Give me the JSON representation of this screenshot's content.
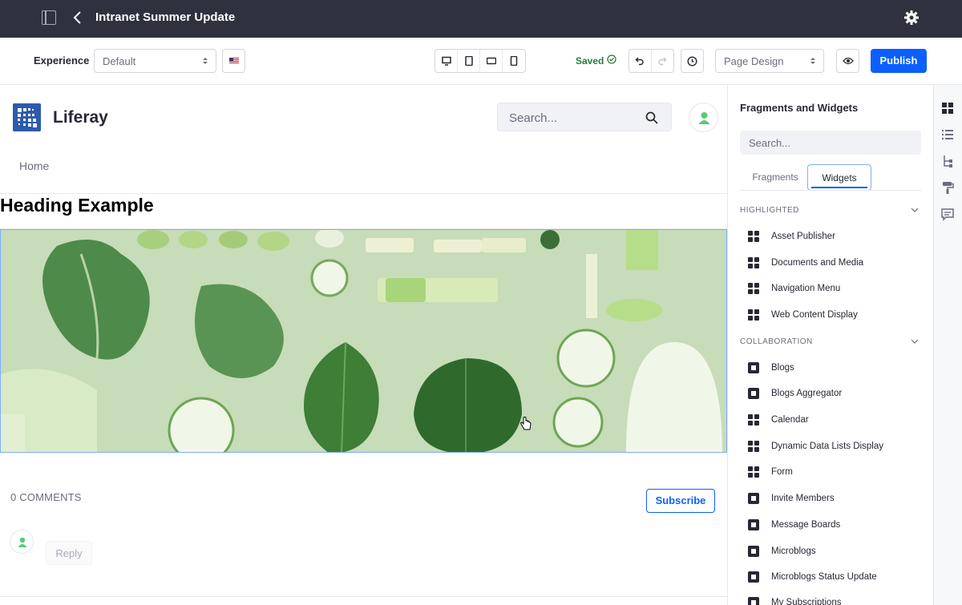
{
  "topbar": {
    "title": "Intranet Summer Update"
  },
  "toolbar": {
    "experience_label": "Experience",
    "experience_value": "Default",
    "saved_label": "Saved",
    "mode_value": "Page Design",
    "publish_label": "Publish"
  },
  "canvas": {
    "logo_text": "Liferay",
    "search_placeholder": "Search...",
    "nav_home": "Home",
    "heading": "Heading Example",
    "comments_label": "0 COMMENTS",
    "subscribe_label": "Subscribe",
    "reply_label": "Reply"
  },
  "panel": {
    "title": "Fragments and Widgets",
    "search_placeholder": "Search...",
    "tabs": [
      "Fragments",
      "Widgets"
    ],
    "active_tab": "Widgets",
    "sections": [
      {
        "name": "HIGHLIGHTED",
        "items": [
          {
            "label": "Asset Publisher",
            "icon": "grid-icon"
          },
          {
            "label": "Documents and Media",
            "icon": "grid-icon"
          },
          {
            "label": "Navigation Menu",
            "icon": "grid-icon"
          },
          {
            "label": "Web Content Display",
            "icon": "grid-icon"
          }
        ]
      },
      {
        "name": "COLLABORATION",
        "items": [
          {
            "label": "Blogs",
            "icon": "box-icon"
          },
          {
            "label": "Blogs Aggregator",
            "icon": "box-icon"
          },
          {
            "label": "Calendar",
            "icon": "grid-icon"
          },
          {
            "label": "Dynamic Data Lists Display",
            "icon": "grid-icon"
          },
          {
            "label": "Form",
            "icon": "grid-icon"
          },
          {
            "label": "Invite Members",
            "icon": "box-icon"
          },
          {
            "label": "Message Boards",
            "icon": "box-icon"
          },
          {
            "label": "Microblogs",
            "icon": "box-icon"
          },
          {
            "label": "Microblogs Status Update",
            "icon": "box-icon"
          },
          {
            "label": "My Subscriptions",
            "icon": "box-icon"
          }
        ]
      }
    ]
  },
  "colors": {
    "topbar_bg": "#30313f",
    "primary": "#0b5fff",
    "saved_green": "#287d3c",
    "logo_blue": "#2e5aac"
  }
}
